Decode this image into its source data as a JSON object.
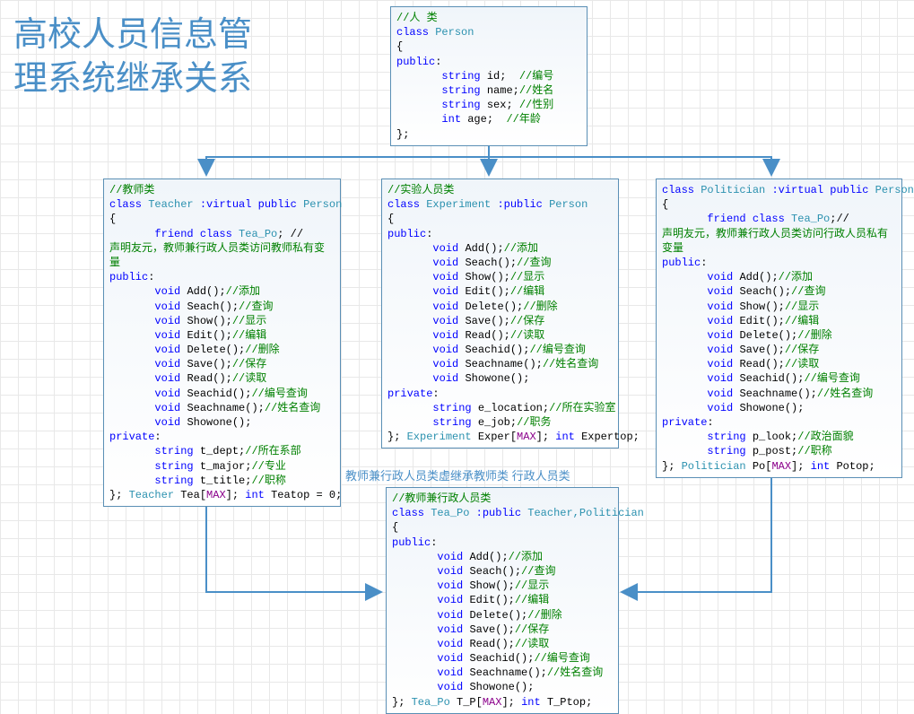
{
  "title": {
    "line1": "高校人员信息管",
    "line2": "理系统继承关系"
  },
  "note": "教师兼行政人员类虚继承教师类 行政人员类",
  "classes": {
    "person": {
      "comment_header": "//人 类",
      "decl_kw": "class",
      "decl_name": "Person",
      "open": "{",
      "public_label": "public",
      "fields": [
        {
          "type": "string",
          "name": "id;",
          "comment": "//编号"
        },
        {
          "type": "string",
          "name": "name;",
          "comment": "//姓名"
        },
        {
          "type": "string",
          "name": "sex;",
          "comment": "//性别"
        },
        {
          "type": "int",
          "name": "age;",
          "comment": "//年龄"
        }
      ],
      "close": "};"
    },
    "teacher": {
      "comment_header": "//教师类",
      "decl_kw": "class",
      "decl_name": "Teacher",
      "inherit_kw": ":virtual public",
      "inherit_name": "Person",
      "open": "{",
      "friend_kw": "friend class",
      "friend_name": "Tea_Po",
      "friend_trail": "; //",
      "friend_note": "声明友元，教师兼行政人员类访问教师私有变量",
      "public_label": "public",
      "methods": [
        {
          "ret": "void",
          "sig": "Add();",
          "comment": "//添加"
        },
        {
          "ret": "void",
          "sig": "Seach();",
          "comment": "//查询"
        },
        {
          "ret": "void",
          "sig": "Show();",
          "comment": "//显示"
        },
        {
          "ret": "void",
          "sig": "Edit();",
          "comment": "//编辑"
        },
        {
          "ret": "void",
          "sig": "Delete();",
          "comment": "//删除"
        },
        {
          "ret": "void",
          "sig": "Save();",
          "comment": "//保存"
        },
        {
          "ret": "void",
          "sig": "Read();",
          "comment": "//读取"
        },
        {
          "ret": "void",
          "sig": "Seachid();",
          "comment": "//编号查询"
        },
        {
          "ret": "void",
          "sig": "Seachname();",
          "comment": "//姓名查询"
        },
        {
          "ret": "void",
          "sig": "Showone();",
          "comment": ""
        }
      ],
      "private_label": "private",
      "priv_fields": [
        {
          "type": "string",
          "name": "t_dept;",
          "comment": "//所在系部"
        },
        {
          "type": "string",
          "name": "t_major;",
          "comment": "//专业"
        },
        {
          "type": "string",
          "name": "t_title;",
          "comment": "//职称"
        }
      ],
      "close_prefix": "}; ",
      "close_type": "Teacher",
      "close_rest1": " Tea[",
      "close_macro": "MAX",
      "close_rest2": "]; ",
      "close_kw": "int",
      "close_rest3": " Teatop = 0;"
    },
    "experiment": {
      "comment_header": "//实验人员类",
      "decl_kw": "class",
      "decl_name": "Experiment",
      "inherit_kw": ":public",
      "inherit_name": "Person",
      "open": "{",
      "public_label": "public",
      "methods": [
        {
          "ret": "void",
          "sig": "Add();",
          "comment": "//添加"
        },
        {
          "ret": "void",
          "sig": "Seach();",
          "comment": "//查询"
        },
        {
          "ret": "void",
          "sig": "Show();",
          "comment": "//显示"
        },
        {
          "ret": "void",
          "sig": "Edit();",
          "comment": "//编辑"
        },
        {
          "ret": "void",
          "sig": "Delete();",
          "comment": "//删除"
        },
        {
          "ret": "void",
          "sig": "Save();",
          "comment": "//保存"
        },
        {
          "ret": "void",
          "sig": "Read();",
          "comment": "//读取"
        },
        {
          "ret": "void",
          "sig": "Seachid();",
          "comment": "//编号查询"
        },
        {
          "ret": "void",
          "sig": "Seachname();",
          "comment": "//姓名查询"
        },
        {
          "ret": "void",
          "sig": "Showone();",
          "comment": ""
        }
      ],
      "private_label": "private",
      "priv_fields": [
        {
          "type": "string",
          "name": "e_location;",
          "comment": "//所在实验室"
        },
        {
          "type": "string",
          "name": "e_job;",
          "comment": "//职务"
        }
      ],
      "close_prefix": "}; ",
      "close_type": "Experiment",
      "close_rest1": " Exper[",
      "close_macro": "MAX",
      "close_rest2": "]; ",
      "close_kw": "int",
      "close_rest3": " Expertop;"
    },
    "politician": {
      "decl_kw": "class",
      "decl_name": "Politician",
      "inherit_kw": ":virtual public",
      "inherit_name": "Person",
      "open": "{",
      "friend_kw": "friend class",
      "friend_name": "Tea_Po",
      "friend_trail": ";//",
      "friend_note": "声明友元，教师兼行政人员类访问行政人员私有变量",
      "public_label": "public",
      "methods": [
        {
          "ret": "void",
          "sig": "Add();",
          "comment": "//添加"
        },
        {
          "ret": "void",
          "sig": "Seach();",
          "comment": "//查询"
        },
        {
          "ret": "void",
          "sig": "Show();",
          "comment": "//显示"
        },
        {
          "ret": "void",
          "sig": "Edit();",
          "comment": "//编辑"
        },
        {
          "ret": "void",
          "sig": "Delete();",
          "comment": "//删除"
        },
        {
          "ret": "void",
          "sig": "Save();",
          "comment": "//保存"
        },
        {
          "ret": "void",
          "sig": "Read();",
          "comment": "//读取"
        },
        {
          "ret": "void",
          "sig": "Seachid();",
          "comment": "//编号查询"
        },
        {
          "ret": "void",
          "sig": "Seachname();",
          "comment": "//姓名查询"
        },
        {
          "ret": "void",
          "sig": "Showone();",
          "comment": ""
        }
      ],
      "private_label": "private",
      "priv_fields": [
        {
          "type": "string",
          "name": "p_look;",
          "comment": "//政治面貌"
        },
        {
          "type": "string",
          "name": "p_post;",
          "comment": "//职称"
        }
      ],
      "close_prefix": "}; ",
      "close_type": "Politician",
      "close_rest1": " Po[",
      "close_macro": "MAX",
      "close_rest2": "]; ",
      "close_kw": "int",
      "close_rest3": " Potop;"
    },
    "teapo": {
      "comment_header": "//教师兼行政人员类",
      "decl_kw": "class",
      "decl_name": "Tea_Po",
      "inherit_kw": ":public",
      "inherit_name": "Teacher,Politician",
      "open": "{",
      "public_label": "public",
      "methods": [
        {
          "ret": "void",
          "sig": "Add();",
          "comment": "//添加"
        },
        {
          "ret": "void",
          "sig": "Seach();",
          "comment": "//查询"
        },
        {
          "ret": "void",
          "sig": "Show();",
          "comment": "//显示"
        },
        {
          "ret": "void",
          "sig": "Edit();",
          "comment": "//编辑"
        },
        {
          "ret": "void",
          "sig": "Delete();",
          "comment": "//删除"
        },
        {
          "ret": "void",
          "sig": "Save();",
          "comment": "//保存"
        },
        {
          "ret": "void",
          "sig": "Read();",
          "comment": "//读取"
        },
        {
          "ret": "void",
          "sig": "Seachid();",
          "comment": "//编号查询"
        },
        {
          "ret": "void",
          "sig": "Seachname();",
          "comment": "//姓名查询"
        },
        {
          "ret": "void",
          "sig": "Showone();",
          "comment": ""
        }
      ],
      "close_prefix": "}; ",
      "close_type": "Tea_Po",
      "close_rest1": " T_P[",
      "close_macro": "MAX",
      "close_rest2": "]; ",
      "close_kw": "int",
      "close_rest3": " T_Ptop;"
    }
  }
}
